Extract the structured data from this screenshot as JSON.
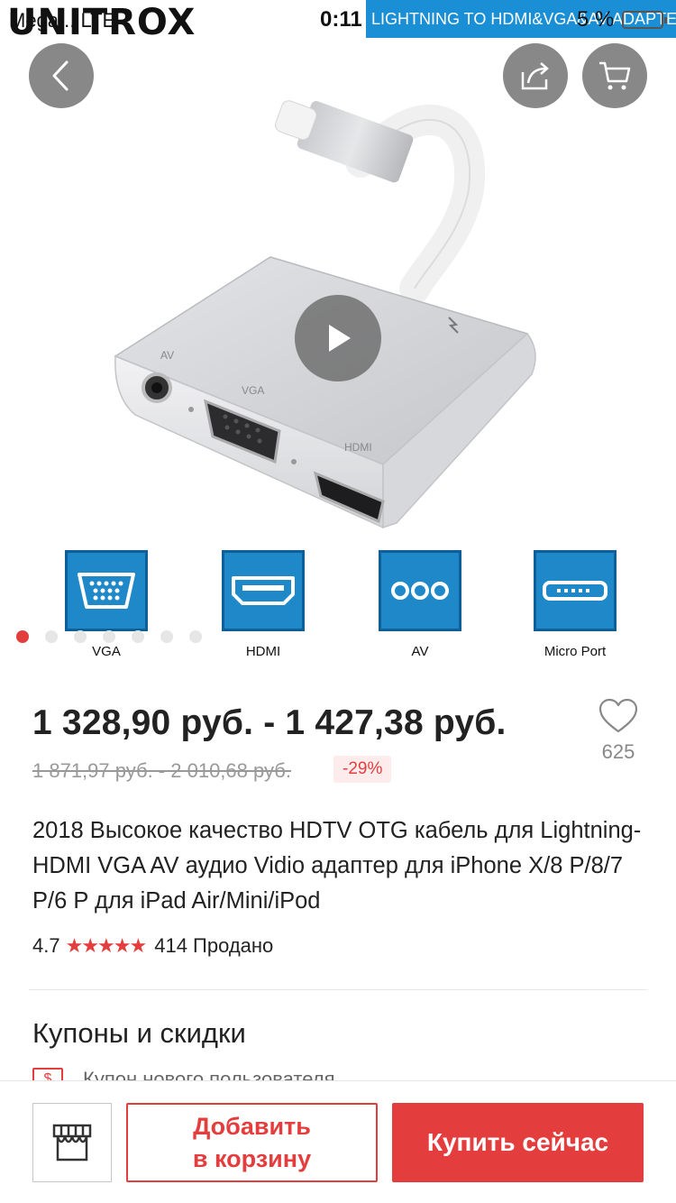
{
  "status_bar": {
    "brand": "UNITROX",
    "carrier": "Mega... LTE",
    "time": "0:11",
    "banner": "LIGHTNING TO HDMI&VGA&AV ADAPTER",
    "battery": "5 %"
  },
  "gallery": {
    "port_labels_on_device": {
      "av": "AV",
      "vga": "VGA",
      "hdmi": "HDMI"
    },
    "ports": [
      {
        "label": "VGA",
        "icon": "vga-port-icon"
      },
      {
        "label": "HDMI",
        "icon": "hdmi-port-icon"
      },
      {
        "label": "AV",
        "icon": "av-port-icon"
      },
      {
        "label": "Micro Port",
        "icon": "micro-port-icon"
      }
    ],
    "dots_total": 7,
    "active_dot": 1
  },
  "product": {
    "price_range": "1 328,90 руб. - 1 427,38 руб.",
    "old_price_range": "1 871,97 руб. - 2 010,68 руб.",
    "discount": "-29%",
    "wishlist_count": "625",
    "title": "2018 Высокое качество HDTV OTG кабель для Lightning-HDMI VGA AV аудио Vidio адаптер для iPhone X/8 P/8/7 P/6 P для iPad Air/Mini/iPod",
    "rating": "4.7",
    "rating_stars": 4.7,
    "sold": "414 Продано"
  },
  "coupons": {
    "title": "Купоны и скидки",
    "first_item": "Купон нового пользователя",
    "icon_text": "$"
  },
  "actions": {
    "add_to_cart_line1": "Добавить",
    "add_to_cart_line2": "в корзину",
    "buy_now": "Купить сейчас"
  },
  "colors": {
    "accent": "#e43d3d",
    "port_tile": "#1e88c8",
    "banner": "#1a8fd6"
  }
}
